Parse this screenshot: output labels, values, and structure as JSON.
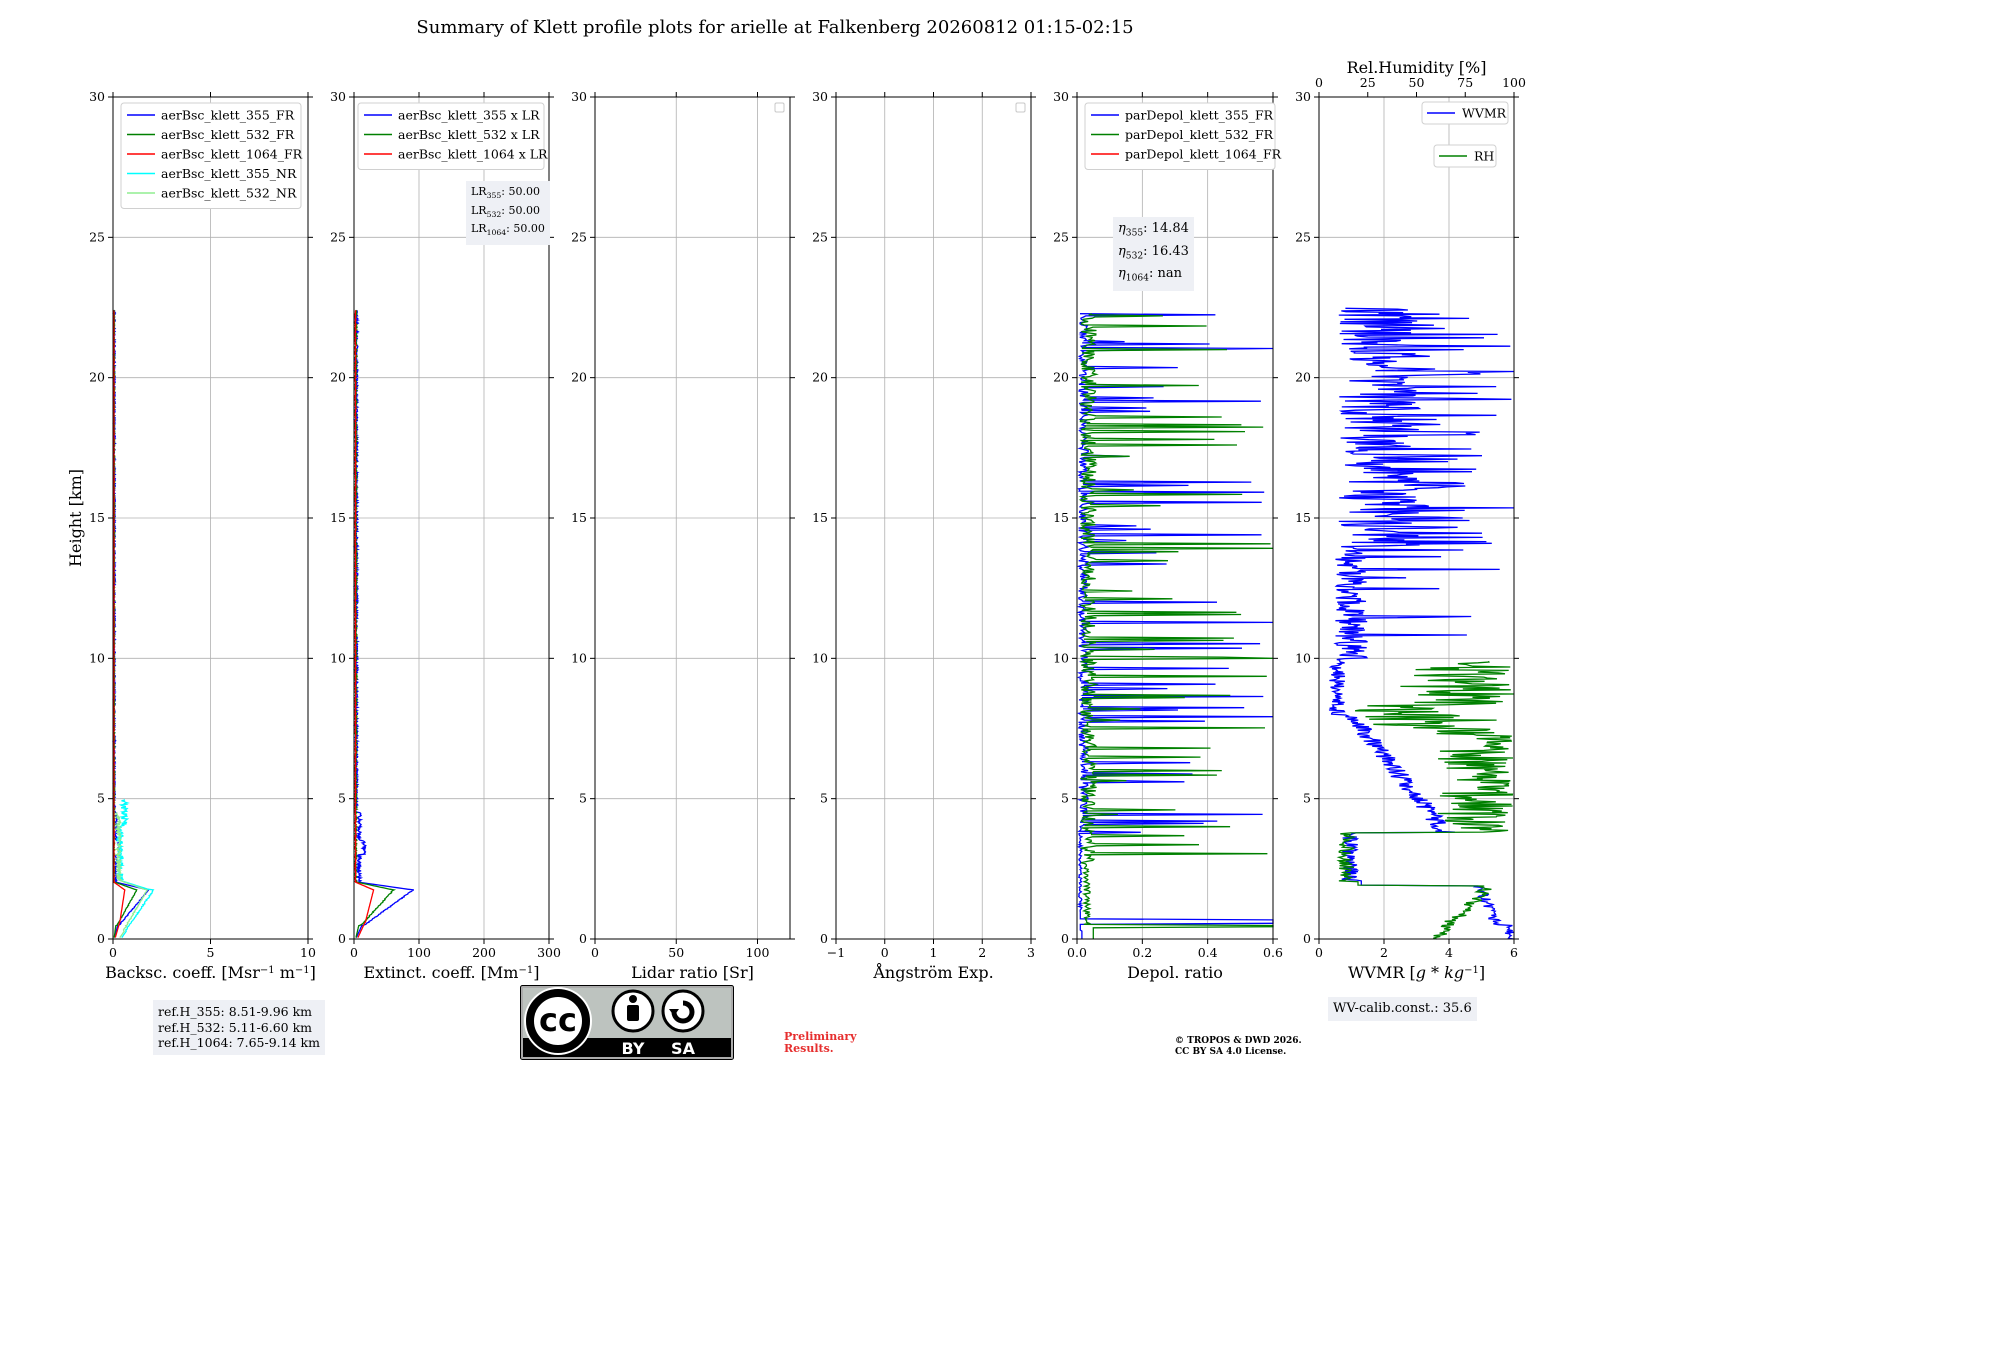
{
  "title": "Summary of Klett profile plots for arielle at Falkenberg 20260812 01:15-02:15",
  "y_axis": {
    "label": "Height [km]",
    "range": [
      0,
      30
    ],
    "ticks": [
      0,
      5,
      10,
      15,
      20,
      25,
      30
    ]
  },
  "chart_data": [
    {
      "type": "line",
      "panel": "backscatter",
      "xlabel_html": "Backsc. coeff. [Msr<tspan baseline-shift=\"super\" font-size=\"10\">−1</tspan> m<tspan baseline-shift=\"super\" font-size=\"10\">−1</tspan>]",
      "xlabel": "Backsc. coeff. [Msr−1 m−1]",
      "xlim": [
        0,
        10
      ],
      "xticks": [
        0,
        5,
        10
      ],
      "ylim": [
        0,
        30
      ],
      "grid": true,
      "legend_position": "top-left",
      "series": [
        {
          "name": "aerBsc_klett_355_FR",
          "color": "#0000ff",
          "shape": "aer355",
          "scale": 1.0
        },
        {
          "name": "aerBsc_klett_532_FR",
          "color": "#008000",
          "shape": "aer532",
          "scale": 1.0
        },
        {
          "name": "aerBsc_klett_1064_FR",
          "color": "#ff0000",
          "shape": "aer1064",
          "scale": 1.0
        },
        {
          "name": "aerBsc_klett_355_NR",
          "color": "#00ffff",
          "shape": "nr355",
          "scale": 1.0
        },
        {
          "name": "aerBsc_klett_532_NR",
          "color": "#90ee90",
          "shape": "nr532",
          "scale": 1.0
        }
      ]
    },
    {
      "type": "line",
      "panel": "extinction",
      "xlabel_html": "Extinct. coeff. [Mm<tspan baseline-shift=\"super\" font-size=\"10\">−1</tspan>]",
      "xlabel": "Extinct. coeff. [Mm−1]",
      "xlim": [
        0,
        300
      ],
      "xticks": [
        0,
        100,
        200,
        300
      ],
      "ylim": [
        0,
        30
      ],
      "grid": true,
      "legend_position": "top-right",
      "series": [
        {
          "name": "aerBsc_klett_355 x LR",
          "color": "#0000ff",
          "shape": "aer355",
          "scale": 50
        },
        {
          "name": "aerBsc_klett_532 x LR",
          "color": "#008000",
          "shape": "aer532",
          "scale": 50
        },
        {
          "name": "aerBsc_klett_1064 x LR",
          "color": "#ff0000",
          "shape": "aer1064",
          "scale": 50
        }
      ]
    },
    {
      "type": "line",
      "panel": "lidar_ratio",
      "xlabel": "Lidar ratio [Sr]",
      "xlim": [
        0,
        120
      ],
      "xticks": [
        0,
        50,
        100
      ],
      "ylim": [
        0,
        30
      ],
      "grid": true,
      "legend_position": "top-right",
      "series": []
    },
    {
      "type": "line",
      "panel": "angstrom",
      "xlabel": "Ångström Exp.",
      "xlim": [
        -1,
        3
      ],
      "xticks": [
        -1,
        0,
        1,
        2,
        3
      ],
      "ylim": [
        0,
        30
      ],
      "grid": true,
      "legend_position": "top-right",
      "series": []
    },
    {
      "type": "line",
      "panel": "depol",
      "xlabel": "Depol. ratio",
      "xlim": [
        0,
        0.6
      ],
      "xticks": [
        0.0,
        0.2,
        0.4,
        0.6
      ],
      "ylim": [
        0,
        30
      ],
      "grid": true,
      "legend_position": "top-left",
      "series": [
        {
          "name": "parDepol_klett_355_FR",
          "color": "#0000ff",
          "shape": "depol355"
        },
        {
          "name": "parDepol_klett_532_FR",
          "color": "#008000",
          "shape": "depol532"
        },
        {
          "name": "parDepol_klett_1064_FR",
          "color": "#ff0000",
          "shape": "none"
        }
      ]
    },
    {
      "type": "line",
      "panel": "wvmr",
      "xlabel_html": "WVMR [<tspan font-style=\"italic\">g</tspan> * <tspan font-style=\"italic\">kg</tspan><tspan baseline-shift=\"super\" font-size=\"10\">−1</tspan>]",
      "xlabel": "WVMR [g*kg−1]",
      "xlim": [
        0,
        6
      ],
      "xticks": [
        0,
        2,
        4,
        6
      ],
      "ylim": [
        0,
        30
      ],
      "grid": true,
      "top_axis": {
        "label": "Rel.Humidity [%]",
        "range": [
          0,
          100
        ],
        "ticks": [
          0,
          25,
          50,
          75,
          100
        ]
      },
      "legend_position": "top-right",
      "series": [
        {
          "name": "WVMR",
          "color": "#0000ff",
          "shape": "wvmr"
        },
        {
          "name": "RH",
          "color": "#008000",
          "shape": "rh"
        }
      ]
    }
  ],
  "lr_box": [
    {
      "sub": "355",
      "value": ": 50.00"
    },
    {
      "sub": "532",
      "value": ": 50.00"
    },
    {
      "sub": "1064",
      "value": ": 50.00"
    }
  ],
  "eta_box": [
    {
      "sub": "355",
      "value": ": 14.84"
    },
    {
      "sub": "532",
      "value": ": 16.43"
    },
    {
      "sub": "1064",
      "value": ": nan"
    }
  ],
  "refh_box": [
    "ref.H_355: 8.51-9.96 km",
    "ref.H_532: 5.11-6.60 km",
    "ref.H_1064: 7.65-9.14 km"
  ],
  "wv_calib": "WV-calib.const.: 35.6",
  "badge": {
    "by": "BY",
    "sa": "SA",
    "cc": "cc"
  },
  "preliminary": [
    "Preliminary",
    "Results."
  ],
  "copyright": [
    "© TROPOS & DWD 2026.",
    "CC BY SA 4.0 License."
  ]
}
